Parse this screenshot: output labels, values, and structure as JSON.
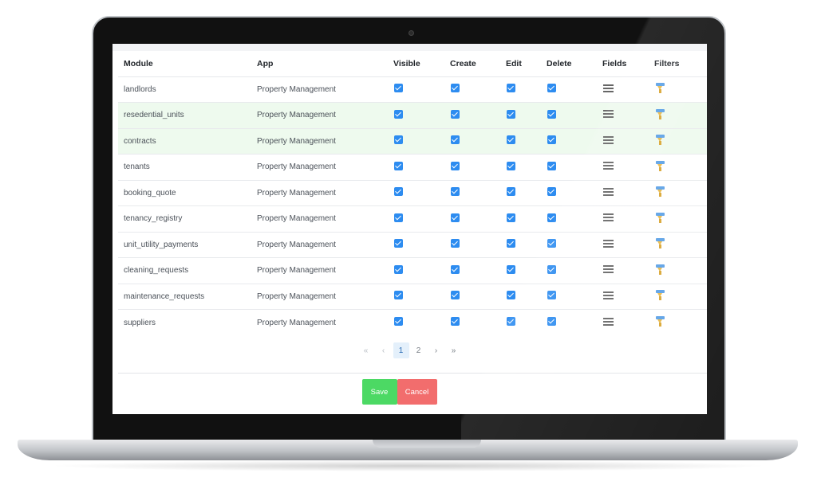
{
  "table": {
    "columns": {
      "module": "Module",
      "app": "App",
      "visible": "Visible",
      "create": "Create",
      "edit": "Edit",
      "delete": "Delete",
      "fields": "Fields",
      "filters": "Filters"
    },
    "rows": [
      {
        "module": "landlords",
        "app": "Property Management",
        "visible": true,
        "create": true,
        "edit": true,
        "delete": true,
        "highlighted": false
      },
      {
        "module": "resedential_units",
        "app": "Property Management",
        "visible": true,
        "create": true,
        "edit": true,
        "delete": true,
        "highlighted": true
      },
      {
        "module": "contracts",
        "app": "Property Management",
        "visible": true,
        "create": true,
        "edit": true,
        "delete": true,
        "highlighted": true
      },
      {
        "module": "tenants",
        "app": "Property Management",
        "visible": true,
        "create": true,
        "edit": true,
        "delete": true,
        "highlighted": false
      },
      {
        "module": "booking_quote",
        "app": "Property Management",
        "visible": true,
        "create": true,
        "edit": true,
        "delete": true,
        "highlighted": false
      },
      {
        "module": "tenancy_registry",
        "app": "Property Management",
        "visible": true,
        "create": true,
        "edit": true,
        "delete": true,
        "highlighted": false
      },
      {
        "module": "unit_utility_payments",
        "app": "Property Management",
        "visible": true,
        "create": true,
        "edit": true,
        "delete": true,
        "highlighted": false
      },
      {
        "module": "cleaning_requests",
        "app": "Property Management",
        "visible": true,
        "create": true,
        "edit": true,
        "delete": true,
        "highlighted": false
      },
      {
        "module": "maintenance_requests",
        "app": "Property Management",
        "visible": true,
        "create": true,
        "edit": true,
        "delete": true,
        "highlighted": false
      },
      {
        "module": "suppliers",
        "app": "Property Management",
        "visible": true,
        "create": true,
        "edit": true,
        "delete": true,
        "highlighted": false
      }
    ],
    "icons": {
      "fields": "menu-lines-icon",
      "filters": "funnel-icon"
    }
  },
  "pagination": {
    "first": "«",
    "prev": "‹",
    "pages": [
      "1",
      "2"
    ],
    "current": "1",
    "next": "›",
    "last": "»"
  },
  "actions": {
    "save_label": "Save",
    "cancel_label": "Cancel"
  },
  "colors": {
    "checkbox": "#2d8cf0",
    "row_highlight": "#eefaee",
    "save": "#4cd964",
    "cancel": "#f26d6d"
  }
}
